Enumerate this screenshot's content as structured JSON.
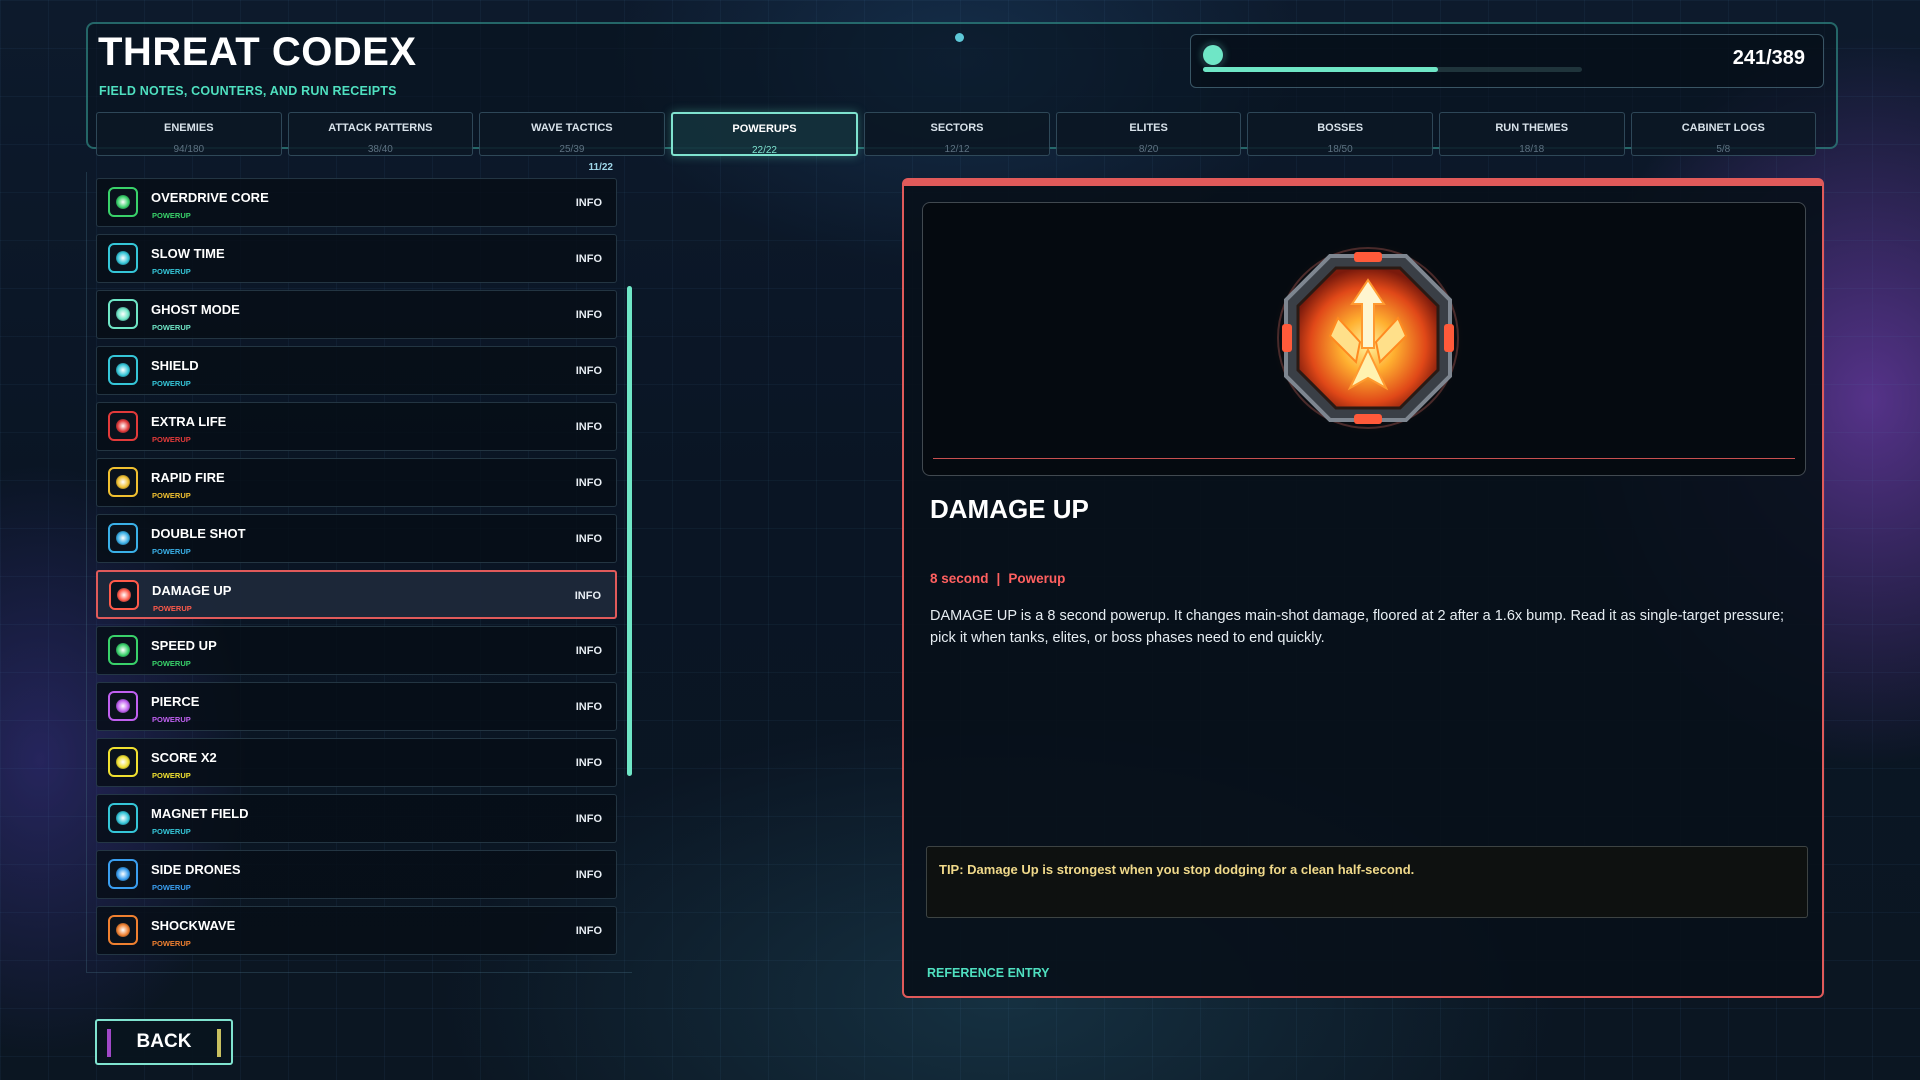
{
  "header": {
    "title": "THREAT CODEX",
    "subtitle": "FIELD NOTES, COUNTERS, AND RUN RECEIPTS",
    "progress_text": "241/389",
    "progress_fraction": 0.62
  },
  "tabs": [
    {
      "label": "ENEMIES",
      "count": "94/180",
      "active": false
    },
    {
      "label": "ATTACK PATTERNS",
      "count": "38/40",
      "active": false
    },
    {
      "label": "WAVE TACTICS",
      "count": "25/39",
      "active": false
    },
    {
      "label": "POWERUPS",
      "count": "22/22",
      "active": true
    },
    {
      "label": "SECTORS",
      "count": "12/12",
      "active": false
    },
    {
      "label": "ELITES",
      "count": "8/20",
      "active": false
    },
    {
      "label": "BOSSES",
      "count": "18/50",
      "active": false
    },
    {
      "label": "RUN THEMES",
      "count": "18/18",
      "active": false
    },
    {
      "label": "CABINET LOGS",
      "count": "5/8",
      "active": false
    }
  ],
  "list": {
    "count": "11/22",
    "info_label": "INFO",
    "items": [
      {
        "name": "OVERDRIVE CORE",
        "tag": "POWERUP",
        "color": "#39d26a",
        "icon": "overdrive-core-icon"
      },
      {
        "name": "SLOW TIME",
        "tag": "POWERUP",
        "color": "#35c6d8",
        "icon": "slow-time-icon"
      },
      {
        "name": "GHOST MODE",
        "tag": "POWERUP",
        "color": "#6fe6c6",
        "icon": "ghost-mode-icon"
      },
      {
        "name": "SHIELD",
        "tag": "POWERUP",
        "color": "#35c6d8",
        "icon": "shield-icon"
      },
      {
        "name": "EXTRA LIFE",
        "tag": "POWERUP",
        "color": "#e23a3a",
        "icon": "heart-icon"
      },
      {
        "name": "RAPID FIRE",
        "tag": "POWERUP",
        "color": "#f0c030",
        "icon": "rapid-fire-icon"
      },
      {
        "name": "DOUBLE SHOT",
        "tag": "POWERUP",
        "color": "#3ab0e8",
        "icon": "double-shot-icon"
      },
      {
        "name": "DAMAGE UP",
        "tag": "POWERUP",
        "color": "#ff5a4a",
        "icon": "damage-up-icon",
        "selected": true
      },
      {
        "name": "SPEED UP",
        "tag": "POWERUP",
        "color": "#39d26a",
        "icon": "speed-up-icon"
      },
      {
        "name": "PIERCE",
        "tag": "POWERUP",
        "color": "#c060f0",
        "icon": "pierce-icon"
      },
      {
        "name": "SCORE X2",
        "tag": "POWERUP",
        "color": "#f0e030",
        "icon": "score-x2-icon"
      },
      {
        "name": "MAGNET FIELD",
        "tag": "POWERUP",
        "color": "#35c6d8",
        "icon": "magnet-field-icon"
      },
      {
        "name": "SIDE DRONES",
        "tag": "POWERUP",
        "color": "#3a9ef0",
        "icon": "side-drones-icon"
      },
      {
        "name": "SHOCKWAVE",
        "tag": "POWERUP",
        "color": "#f08030",
        "icon": "shockwave-icon"
      }
    ]
  },
  "detail": {
    "title": "DAMAGE UP",
    "duration": "8 second",
    "separator": "|",
    "category": "Powerup",
    "description": "DAMAGE UP is a 8 second powerup. It changes main-shot damage, floored at 2 after a 1.6x bump. Read it as single-target pressure; pick it when tanks, elites, or boss phases need to end quickly.",
    "tip": "TIP: Damage Up is strongest when you stop dodging for a clean half-second.",
    "reference": "REFERENCE ENTRY",
    "accent_color": "#e05a5a",
    "art_icon": "damage-up-emblem-icon"
  },
  "footer": {
    "back_label": "BACK"
  }
}
